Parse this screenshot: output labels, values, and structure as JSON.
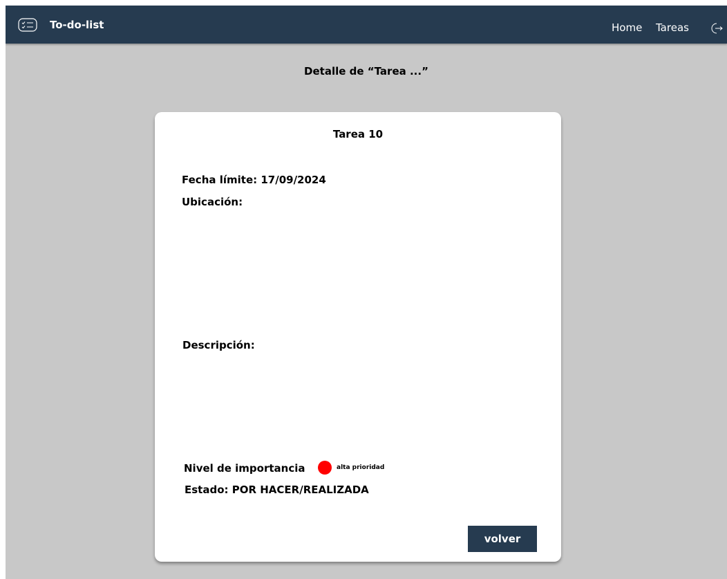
{
  "navbar": {
    "brand_icon": "checklist-icon",
    "brand_title": "To-do-list",
    "links": [
      {
        "label": "Home"
      },
      {
        "label": "Tareas"
      }
    ],
    "logout_icon": "logout-icon",
    "background": "#263b50"
  },
  "page": {
    "title": "Detalle de “Tarea ...”"
  },
  "task": {
    "title": "Tarea 10",
    "due_date": "Fecha límite: 17/09/2024",
    "location_label": "Ubicación:",
    "description_label": "Descripción:",
    "importance_label": "Nivel de importancia",
    "priority_label": "alta prioridad",
    "priority_color": "#ff0000",
    "status": "Estado: POR HACER/REALIZADA"
  },
  "actions": {
    "back_label": "volver"
  }
}
